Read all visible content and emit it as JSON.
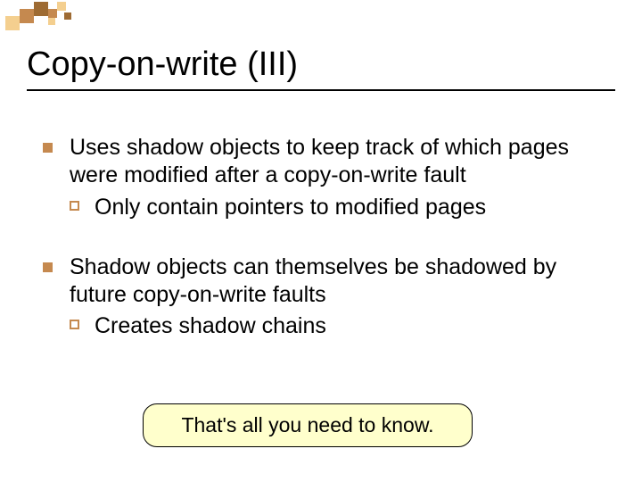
{
  "title": "Copy-on-write (III)",
  "bullets": [
    {
      "text": "Uses shadow objects to keep track of which pages were modified after a copy-on-write fault",
      "sub": [
        {
          "text": "Only contain pointers to modified pages"
        }
      ]
    },
    {
      "text": "Shadow objects can themselves be shadowed by future copy-on-write faults",
      "sub": [
        {
          "text": "Creates shadow chains"
        }
      ]
    }
  ],
  "callout": "That's all you need to know.",
  "colors": {
    "accent": "#c5894f",
    "deco_dark": "#9e6b33",
    "deco_light": "#f4cf8f",
    "callout_bg": "#ffffcc"
  }
}
